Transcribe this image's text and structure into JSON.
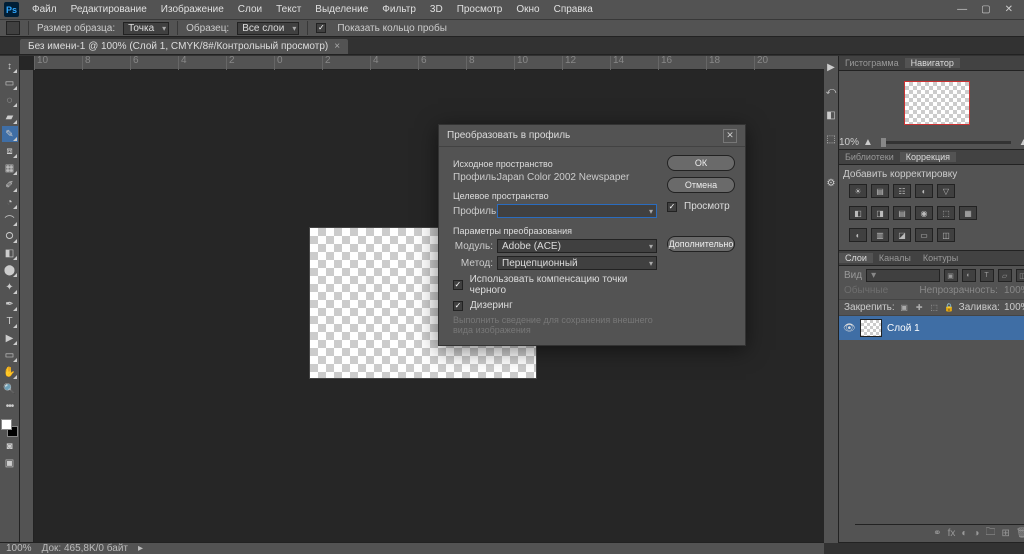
{
  "app": {
    "logo": "Ps"
  },
  "menu": [
    "Файл",
    "Редактирование",
    "Изображение",
    "Слои",
    "Текст",
    "Выделение",
    "Фильтр",
    "3D",
    "Просмотр",
    "Окно",
    "Справка"
  ],
  "options": {
    "sample_size_label": "Размер образца:",
    "sample_size_value": "Точка",
    "sample_label": "Образец:",
    "sample_value": "Все слои",
    "show_ring": "Показать кольцо пробы"
  },
  "doc_tab": {
    "title": "Без имени-1 @ 100% (Слой 1, CMYK/8#/Контрольный просмотр)"
  },
  "ruler_ticks": [
    "10",
    "8",
    "6",
    "4",
    "2",
    "0",
    "2",
    "4",
    "6",
    "8",
    "10",
    "12",
    "14",
    "16",
    "18",
    "20"
  ],
  "tools": [
    "↕",
    "▭",
    "◌",
    "▰",
    "✎",
    "⧈",
    "▦",
    "✐",
    "◔",
    "⌒",
    "⭘",
    "◧",
    "T",
    "▶",
    "✋",
    "🔍"
  ],
  "right_icons": [
    "▶",
    "⤺",
    "◧",
    "⬚",
    "⚙"
  ],
  "panels": {
    "nav_tabs": {
      "histogram": "Гистограмма",
      "navigator": "Навигатор",
      "nav_zoom": "10%"
    },
    "lib_tabs": {
      "libraries": "Библиотеки",
      "correction": "Коррекция"
    },
    "corr_title": "Добавить корректировку",
    "layer_tabs": {
      "layers": "Слои",
      "channels": "Каналы",
      "paths": "Контуры"
    },
    "layers": {
      "kind_label": "Вид",
      "blend": "Обычные",
      "opacity_label": "Непрозрачность:",
      "opacity_val": "100%",
      "lock_label": "Закрепить:",
      "fill_label": "Заливка:",
      "fill_val": "100%",
      "layer1": "Слой 1"
    }
  },
  "status": {
    "zoom": "100%",
    "doc": "Док: 465,8K/0 байт"
  },
  "dialog": {
    "title": "Преобразовать в профиль",
    "source_header": "Исходное пространство",
    "profile_label": "Профиль:",
    "source_profile": "Japan Color 2002 Newspaper",
    "target_header": "Целевое пространство",
    "target_profile": "",
    "params_header": "Параметры преобразования",
    "engine_label": "Модуль:",
    "engine_value": "Adobe (ACE)",
    "intent_label": "Метод:",
    "intent_value": "Перцепционный",
    "bpc": "Использовать компенсацию точки черного",
    "dither": "Дизеринг",
    "flatten_disabled": "Выполнить сведение для сохранения внешнего вида изображения",
    "ok": "ОК",
    "cancel": "Отмена",
    "preview": "Просмотр",
    "advanced": "Дополнительно"
  }
}
